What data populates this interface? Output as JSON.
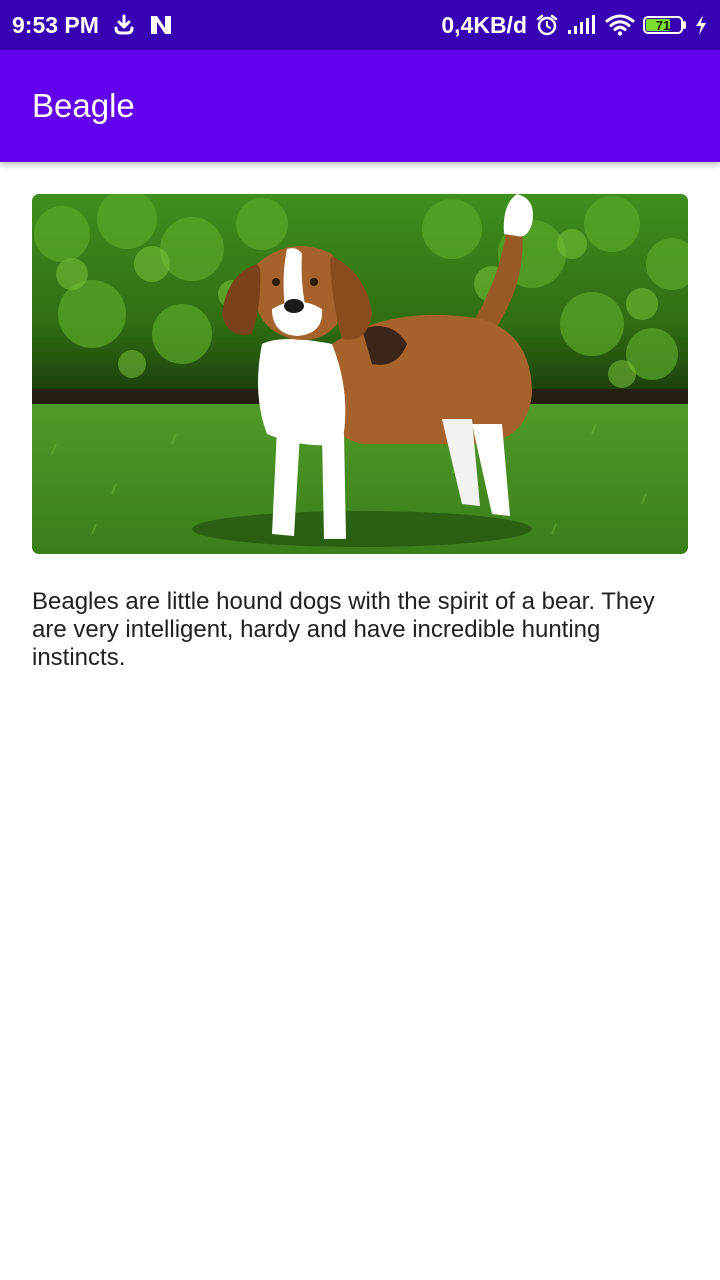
{
  "status_bar": {
    "time": "9:53 PM",
    "network_speed": "0,4KB/d",
    "battery_level": 71,
    "battery_text": "71",
    "icons": [
      "download-icon",
      "n-logo-icon",
      "alarm-icon",
      "signal-icon",
      "wifi-icon",
      "battery-icon",
      "charging-icon"
    ]
  },
  "app_bar": {
    "title": "Beagle"
  },
  "content": {
    "image_subject": "beagle-dog-photo",
    "description": "Beagles are little hound dogs with the spirit of a bear. They are very intelligent, hardy and have incredible hunting instincts."
  },
  "colors": {
    "status_bar": "#3700b3",
    "app_bar": "#6200ee",
    "battery_fill": "#7cdd2a"
  }
}
